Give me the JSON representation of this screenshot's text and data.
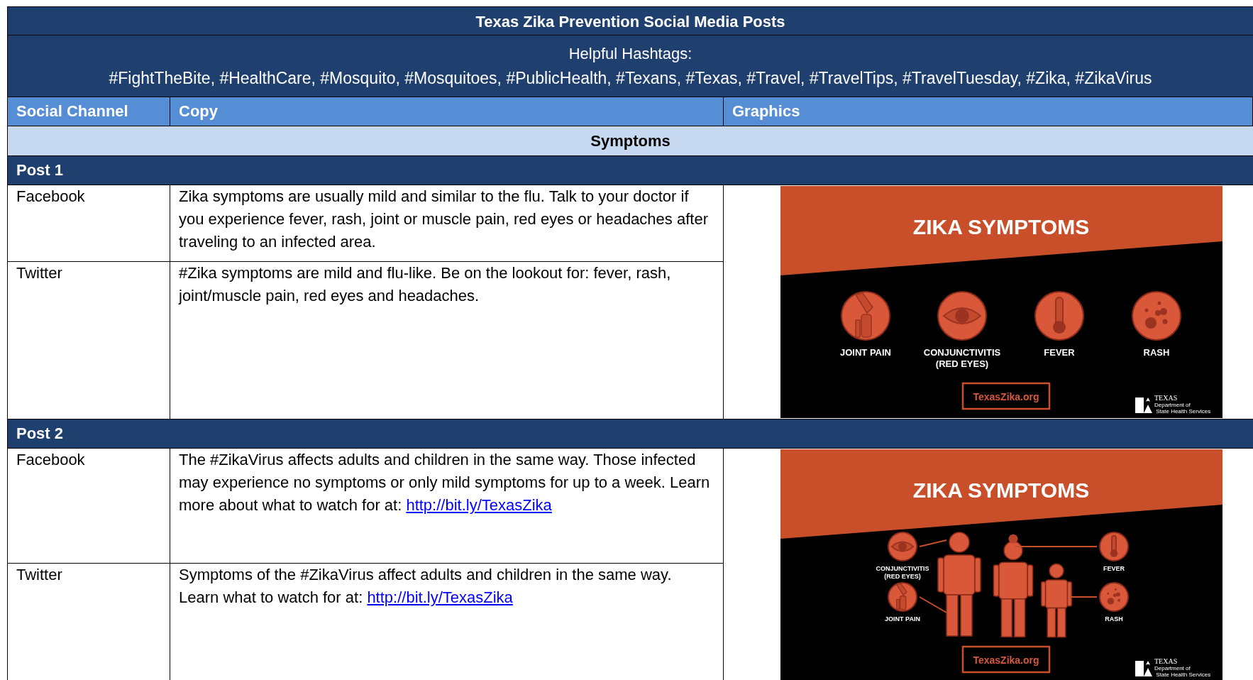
{
  "document": {
    "title": "Texas Zika Prevention Social Media Posts",
    "hashtags_label": "Helpful Hashtags:",
    "hashtags": "#FightTheBite, #HealthCare, #Mosquito, #Mosquitoes, #PublicHealth, #Texans, #Texas, #Travel, #TravelTips, #TravelTuesday, #Zika, #ZikaVirus"
  },
  "table": {
    "columns": [
      "Social Channel",
      "Copy",
      "Graphics"
    ],
    "sections": [
      {
        "title": "Symptoms",
        "posts": [
          {
            "label": "Post 1",
            "rows": [
              {
                "channel": "Facebook",
                "copy": "Zika symptoms are usually mild and similar to the flu. Talk to your doctor if you experience fever, rash, joint or muscle pain, red eyes or headaches after traveling to an infected area."
              },
              {
                "channel": "Twitter",
                "copy": "#Zika symptoms are mild and flu-like. Be on the lookout for: fever, rash, joint/muscle pain, red eyes and headaches."
              }
            ],
            "graphic": {
              "kind": "icons",
              "title": "ZIKA SYMPTOMS",
              "symptoms": [
                {
                  "kind": "joint",
                  "label": "JOINT PAIN"
                },
                {
                  "kind": "eye",
                  "label": "CONJUNCTIVITIS\n(RED EYES)"
                },
                {
                  "kind": "thermometer",
                  "label": "FEVER"
                },
                {
                  "kind": "rash",
                  "label": "RASH"
                }
              ],
              "website": "TexasZika.org",
              "logo_text": "TEXAS",
              "logo_subtitle": "Department of State Health Services"
            }
          },
          {
            "label": "Post 2",
            "rows": [
              {
                "channel": "Facebook",
                "copy": "The #ZikaVirus affects adults and children in the same way. Those infected may experience no symptoms or only mild symptoms for up to a week. Learn more about what to watch for at: ",
                "link": "http://bit.ly/TexasZika"
              },
              {
                "channel": "Twitter",
                "copy": "Symptoms of the #ZikaVirus affect adults and children in the same way. Learn what to watch for at: ",
                "link": "http://bit.ly/TexasZika"
              }
            ],
            "graphic": {
              "kind": "family",
              "title": "ZIKA SYMPTOMS",
              "symptoms": [
                {
                  "kind": "eye",
                  "label": "CONJUNCTIVITIS\n(RED EYES)"
                },
                {
                  "kind": "joint",
                  "label": "JOINT PAIN"
                },
                {
                  "kind": "thermometer",
                  "label": "FEVER"
                },
                {
                  "kind": "rash",
                  "label": "RASH"
                }
              ],
              "website": "TexasZika.org",
              "logo_text": "TEXAS",
              "logo_subtitle": "Department of State Health Services"
            }
          }
        ]
      }
    ]
  }
}
